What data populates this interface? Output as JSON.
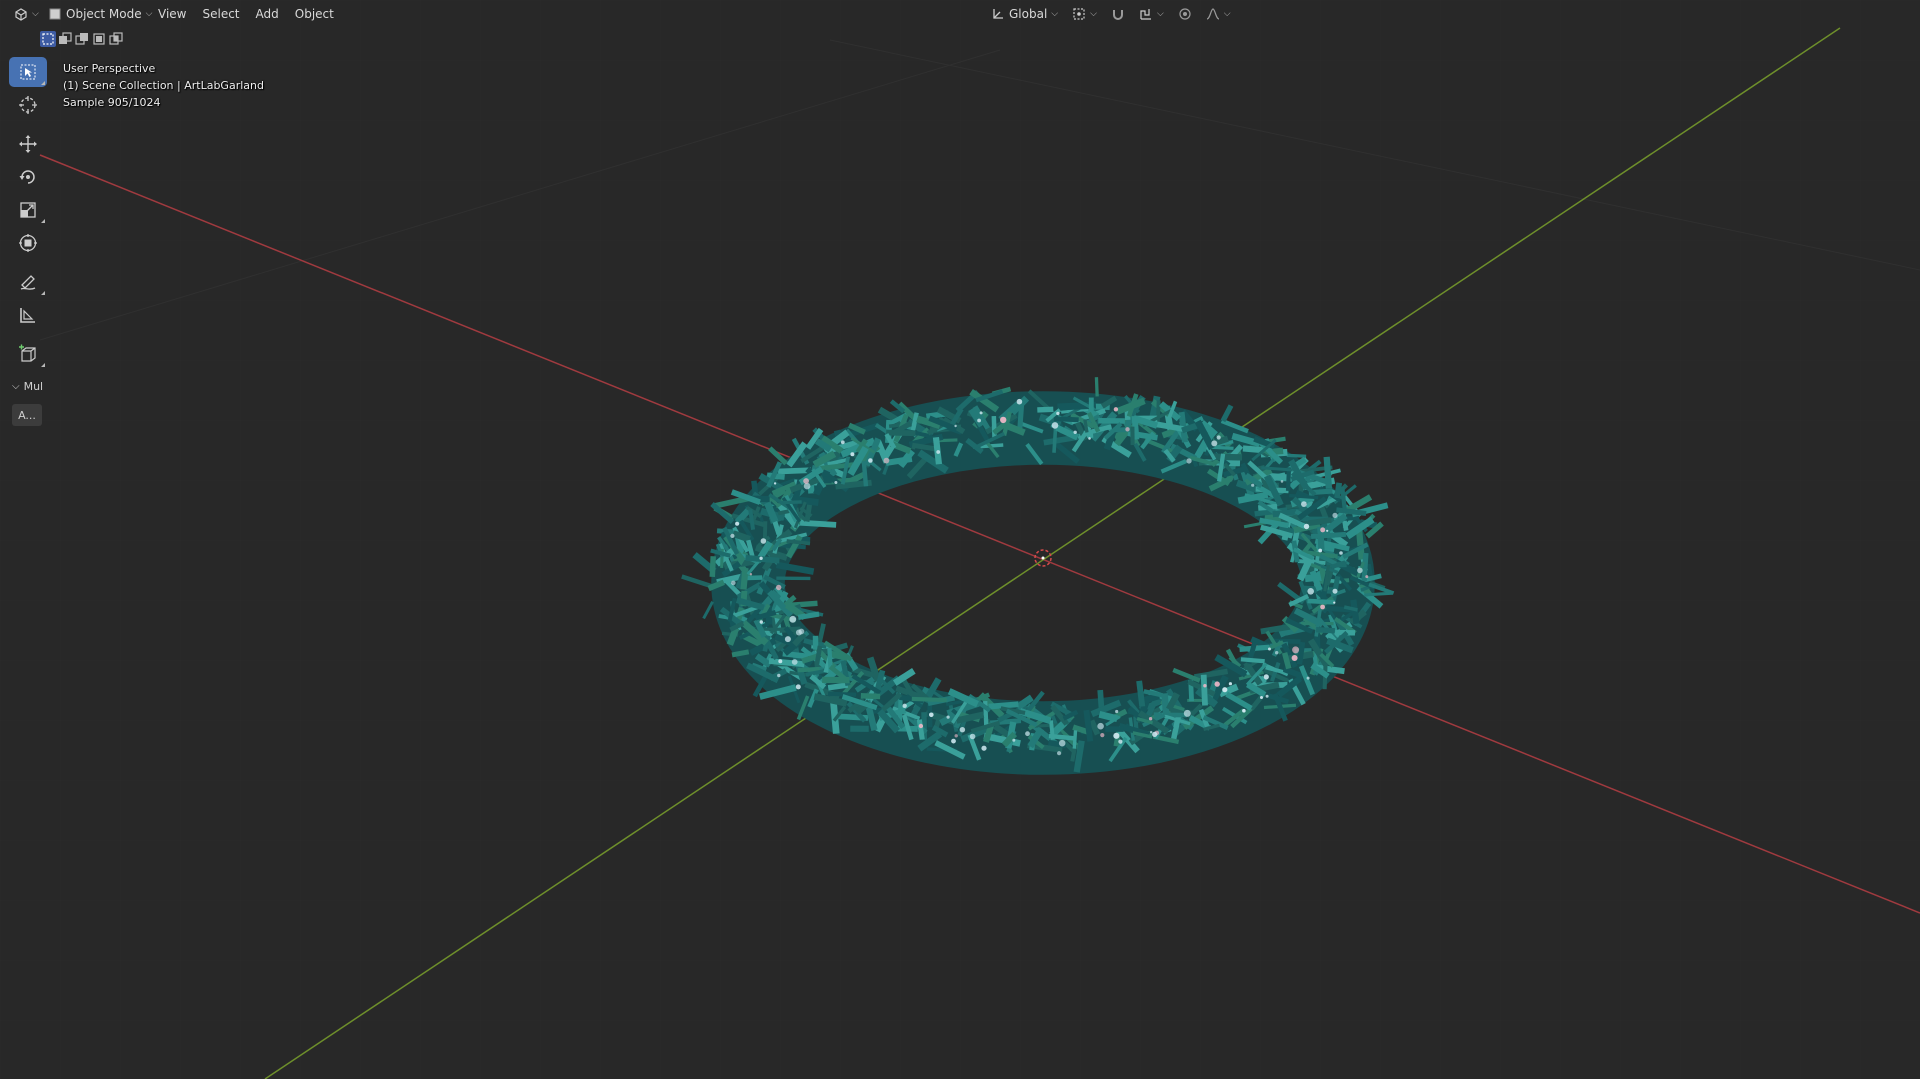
{
  "header": {
    "editor_type_icon": "viewport-3d-icon",
    "mode": "Object Mode",
    "menu": [
      "View",
      "Select",
      "Add",
      "Object"
    ],
    "transform_orientation": "Global"
  },
  "selection_modes": [
    "select-new-icon",
    "select-extend-icon",
    "select-subtract-icon",
    "select-invert-icon",
    "select-intersect-icon"
  ],
  "overlay": {
    "view_name": "User Perspective",
    "collection_line": "(1) Scene Collection | ArtLabGarland",
    "sample_line": "Sample 905/1024"
  },
  "toolbar": {
    "tools": [
      "select-box-icon",
      "cursor-icon",
      "move-icon",
      "rotate-icon",
      "scale-icon",
      "transform-icon",
      "annotate-icon",
      "measure-icon",
      "add-cube-icon"
    ],
    "active_tool": "select-box-icon"
  },
  "last_operator": {
    "label": "Mul",
    "button": "A..."
  },
  "colors": {
    "background": "#282828",
    "x_axis": "#a03a3f",
    "y_axis": "#6e8f2b",
    "garland": "#1f6e6e",
    "active_tool": "#4772b3"
  }
}
